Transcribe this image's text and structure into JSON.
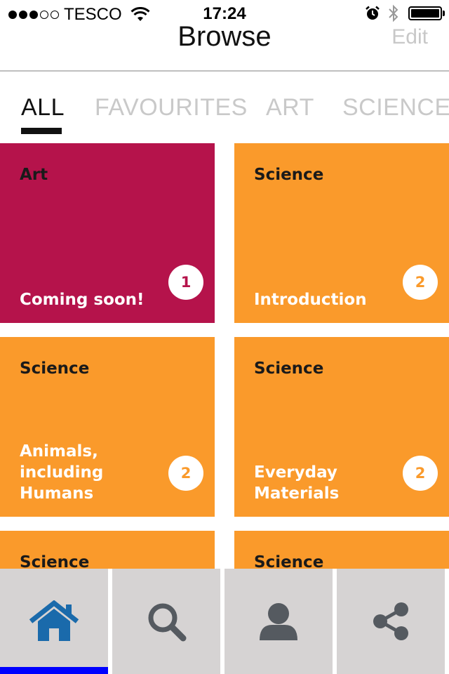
{
  "status_bar": {
    "carrier": "TESCO",
    "time": "17:24",
    "signal_bars_full": 3,
    "signal_bars_total": 5
  },
  "nav": {
    "title": "Browse",
    "edit_label": "Edit"
  },
  "tabs": [
    {
      "label": "ALL",
      "active": true
    },
    {
      "label": "FAVOURITES",
      "active": false
    },
    {
      "label": "ART",
      "active": false
    },
    {
      "label": "SCIENCE",
      "active": false
    }
  ],
  "cards": [
    {
      "category": "Art",
      "title": "Coming soon!",
      "count": "1",
      "color": "#b5134b"
    },
    {
      "category": "Science",
      "title": "Introduction",
      "count": "2",
      "color": "#fa9a2b"
    },
    {
      "category": "Science",
      "title": "Animals, including Humans",
      "count": "2",
      "color": "#fa9a2b"
    },
    {
      "category": "Science",
      "title": "Everyday Materials",
      "count": "2",
      "color": "#fa9a2b"
    },
    {
      "category": "Science",
      "title": "",
      "count": "",
      "color": "#fa9a2b"
    },
    {
      "category": "Science",
      "title": "",
      "count": "",
      "color": "#fa9a2b"
    }
  ],
  "tabbar": {
    "items": [
      {
        "icon": "home-icon",
        "active": true
      },
      {
        "icon": "search-icon",
        "active": false
      },
      {
        "icon": "profile-icon",
        "active": false
      },
      {
        "icon": "share-icon",
        "active": false
      }
    ],
    "active_color": "#0000ff",
    "home_icon_color": "#1a6aab",
    "icon_color": "#555a60"
  }
}
